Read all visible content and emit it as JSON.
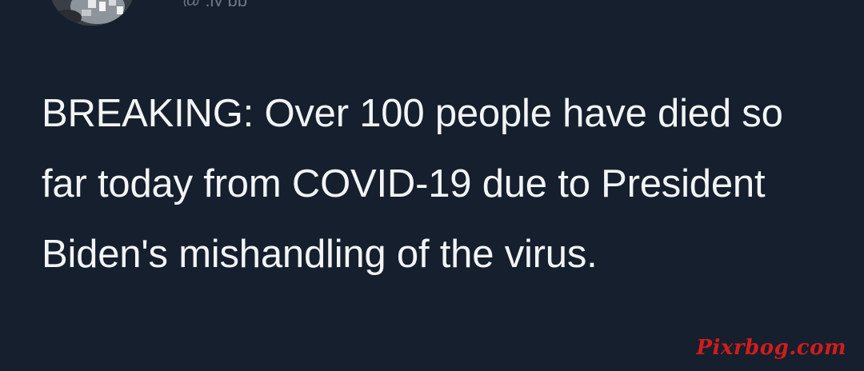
{
  "tweet": {
    "text": "BREAKING: Over 100 people have died so far today from COVID-19 due to President Biden's mishandling of the virus."
  },
  "author": {
    "handle_partial": "@      .jy  pp"
  },
  "watermark": {
    "text": "Pixrbog.com"
  },
  "colors": {
    "background": "#151f2d",
    "text": "#f2f4f6",
    "watermark": "#d11c1c"
  }
}
